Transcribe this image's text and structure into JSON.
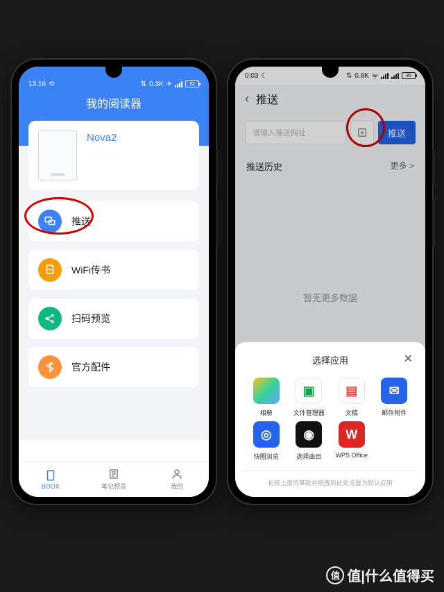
{
  "left": {
    "status": {
      "time": "13:16",
      "net": "0.3K",
      "battery": "82"
    },
    "title": "我的阅读器",
    "device": {
      "name": "Nova2",
      "sub": "··· ··· ···"
    },
    "menu": [
      {
        "id": "push",
        "label": "推送",
        "color": "#3b82f6"
      },
      {
        "id": "wifi",
        "label": "WiFi传书",
        "color": "#f59e0b"
      },
      {
        "id": "scan",
        "label": "扫码预览",
        "color": "#10b981"
      },
      {
        "id": "official",
        "label": "官方配件",
        "color": "#fb923c"
      }
    ],
    "tabs": [
      {
        "id": "boox",
        "label": "BOOX"
      },
      {
        "id": "notes",
        "label": "笔记预览"
      },
      {
        "id": "mine",
        "label": "我的"
      }
    ]
  },
  "right": {
    "status": {
      "time": "0:03",
      "net": "0.8K",
      "battery": "95"
    },
    "title": "推送",
    "input_placeholder": "请输入推送网址",
    "push_btn": "推送",
    "history_label": "推送历史",
    "more_label": "更多 >",
    "empty_label": "暂无更多数据",
    "sheet": {
      "title": "选择应用",
      "apps": [
        {
          "id": "gallery",
          "label": "相册",
          "bg": "linear-gradient(135deg,#fbbf24,#34d399,#60a5fa)"
        },
        {
          "id": "files",
          "label": "文件管理器",
          "bg": "#fff",
          "fg": "#16a34a",
          "glyph": "▣"
        },
        {
          "id": "docs",
          "label": "文稿",
          "bg": "#fff",
          "fg": "#ef4444",
          "glyph": "▤"
        },
        {
          "id": "mail",
          "label": "邮件附件",
          "bg": "#2563eb",
          "glyph": "✉"
        },
        {
          "id": "browser",
          "label": "快图浏览",
          "bg": "#2563eb",
          "glyph": "◎"
        },
        {
          "id": "tracks",
          "label": "选择曲目",
          "bg": "#111",
          "glyph": "◉"
        },
        {
          "id": "wps",
          "label": "WPS Office",
          "bg": "#dc2626",
          "glyph": "W"
        }
      ],
      "footer": "长按上面的某款并拖拽到此处设置为默认应用"
    }
  },
  "watermark": "值|什么值得买"
}
